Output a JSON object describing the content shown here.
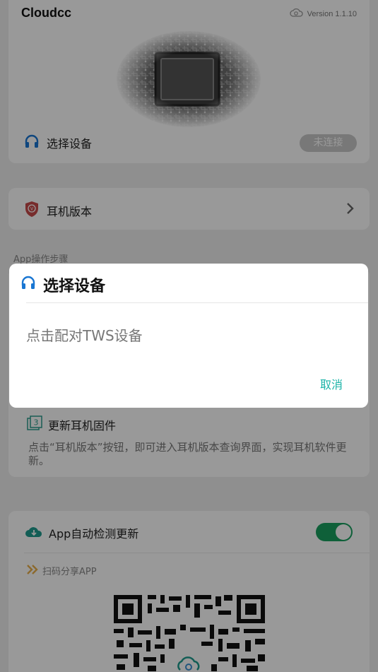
{
  "header": {
    "app_title": "Cloudcc",
    "version": "Version 1.1.10",
    "select_device_label": "选择设备",
    "connection_status": "未连接"
  },
  "firmware_row": {
    "label": "耳机版本"
  },
  "steps_section": {
    "label": "App操作步骤",
    "step3_number": "3",
    "step3_title": "更新耳机固件",
    "step3_desc": "点击“耳机版本”按钮，即可进入耳机版本查询界面，实现耳机软件更新。"
  },
  "update_card": {
    "auto_update_label": "App自动检测更新",
    "auto_update_enabled": true,
    "share_label": "扫码分享APP"
  },
  "dialog": {
    "title": "选择设备",
    "message": "点击配对TWS设备",
    "cancel_label": "取消"
  },
  "colors": {
    "accent_blue": "#1976d2",
    "toggle_green": "#1aa160",
    "cancel_teal": "#19b3a7",
    "share_arrow": "#e8b04a",
    "cloud_teal": "#1e9c8e"
  },
  "icons": [
    "cloud-icon",
    "headphones-icon",
    "shield-badge-icon",
    "chevron-right-icon",
    "step-number-icon",
    "cloud-download-icon",
    "double-chevron-icon",
    "qr-code"
  ]
}
